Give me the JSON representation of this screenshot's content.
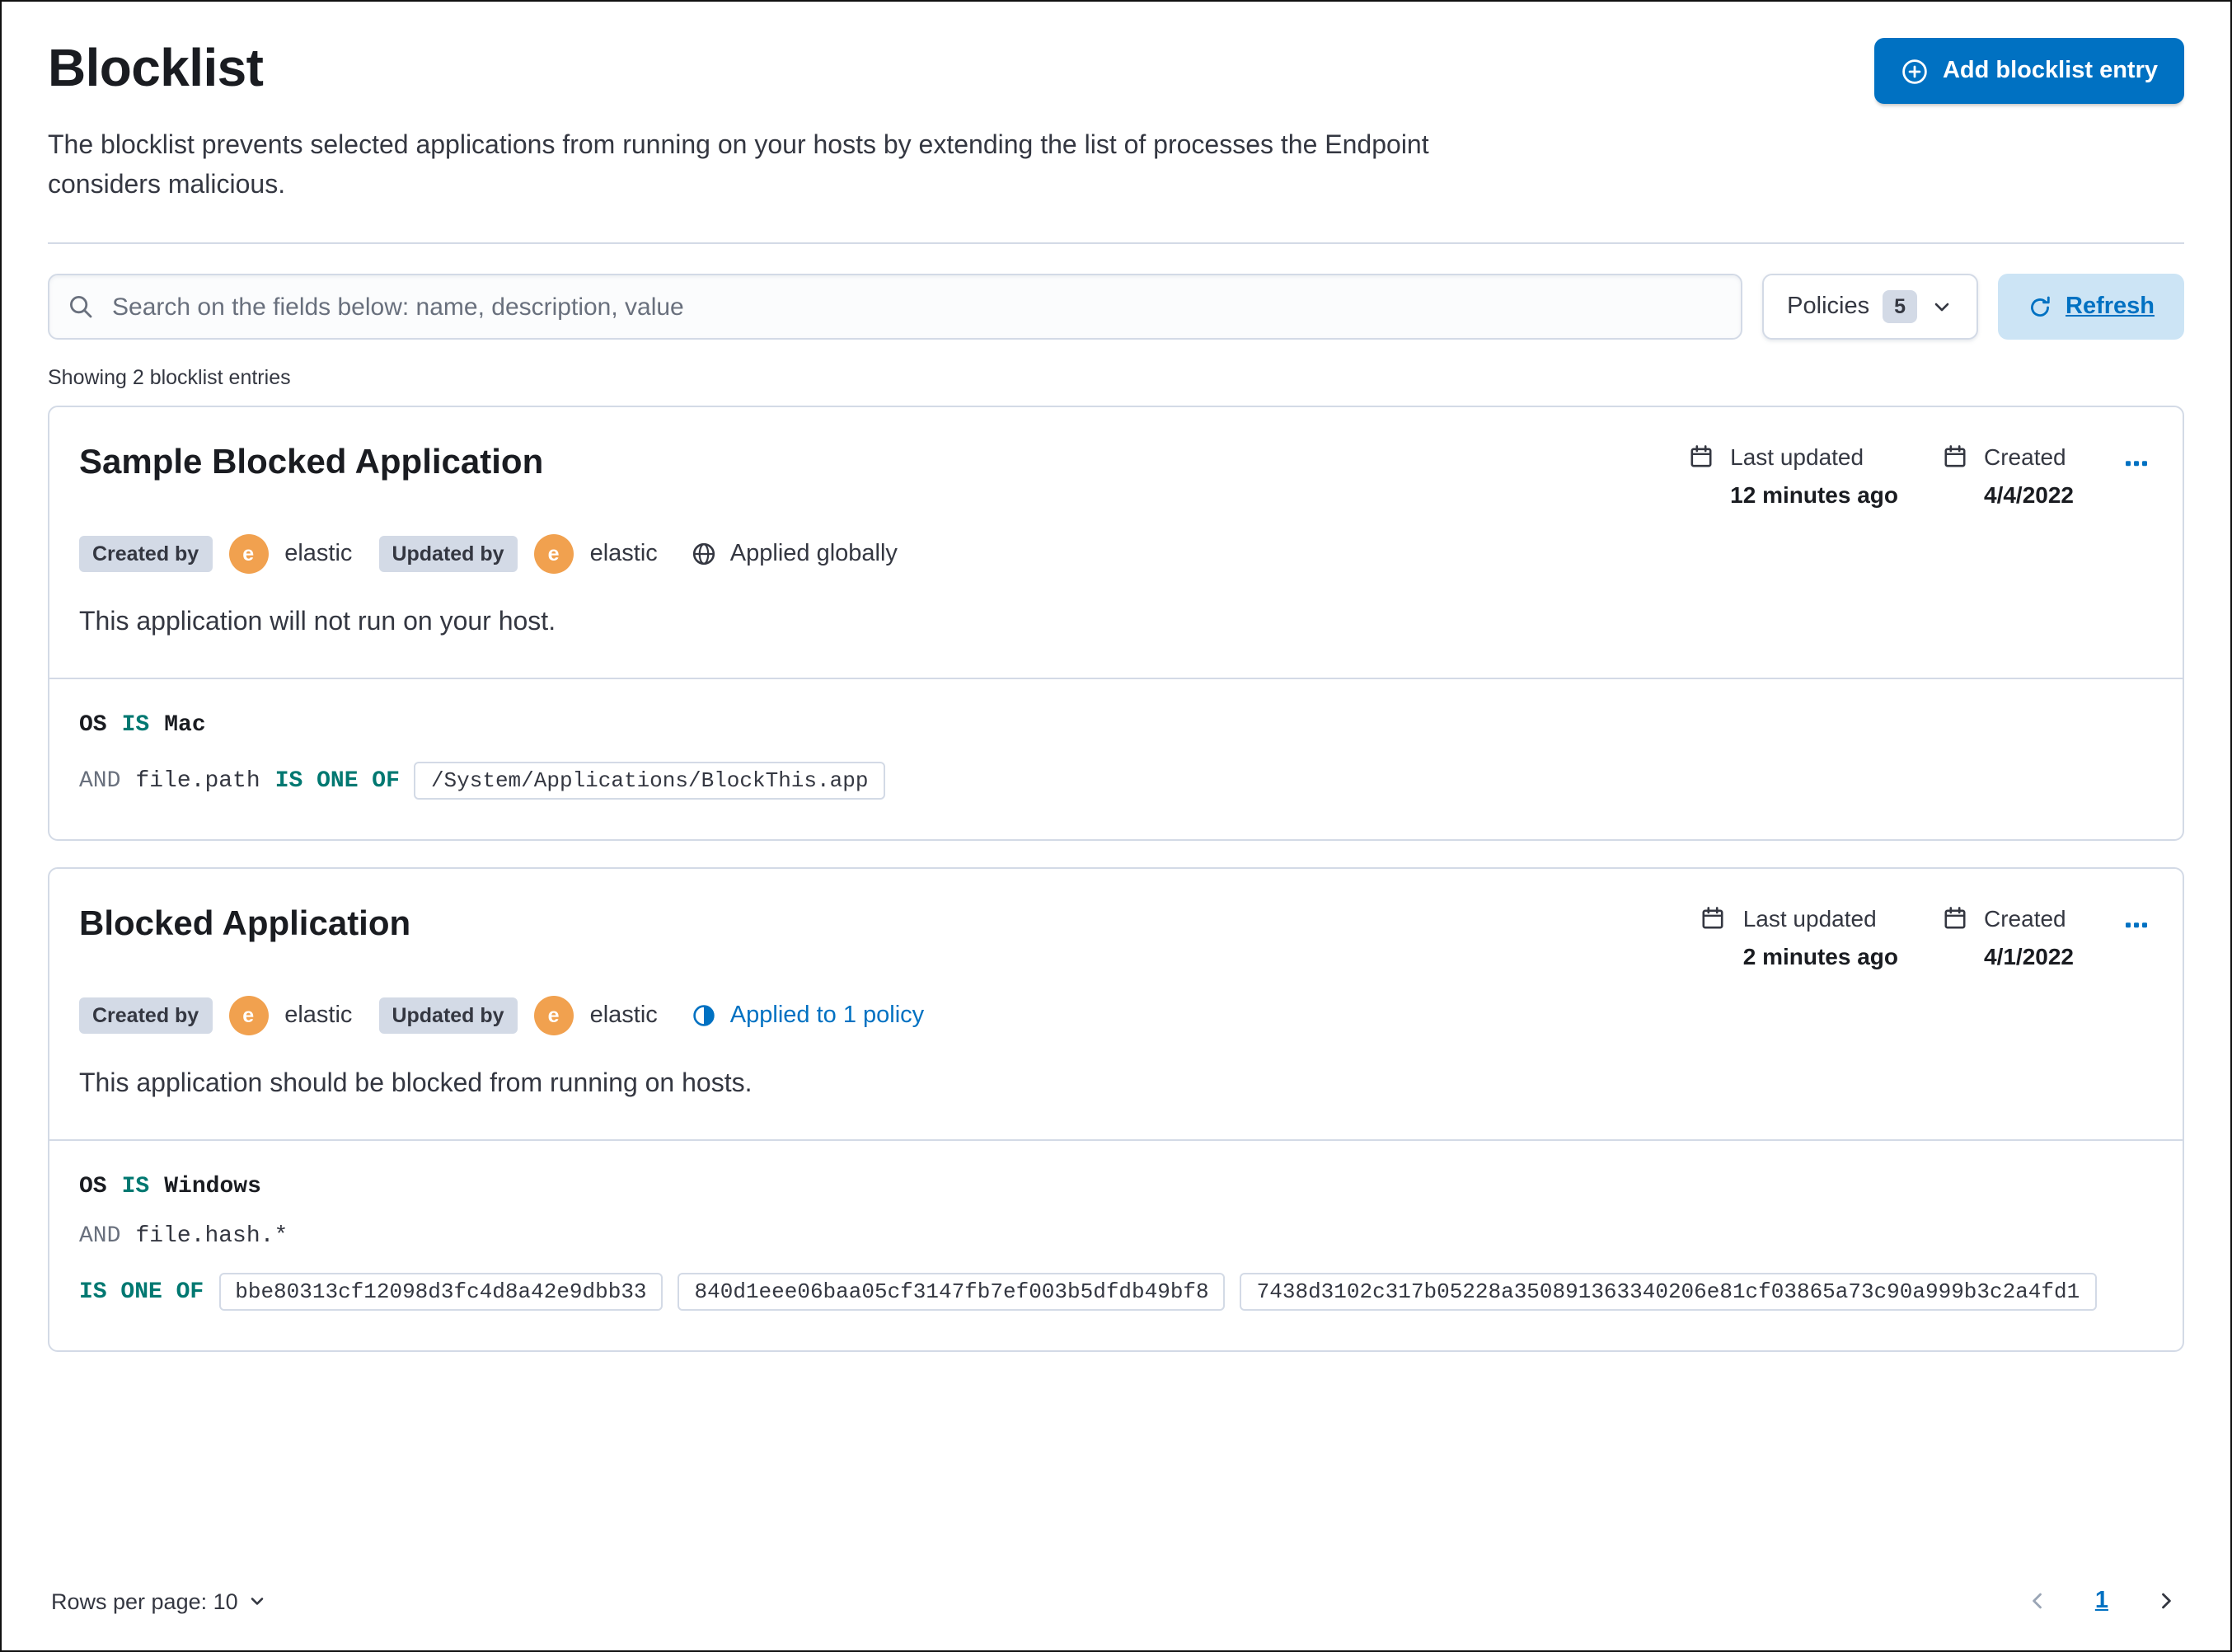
{
  "header": {
    "title": "Blocklist",
    "description": "The blocklist prevents selected applications from running on your hosts by extending the list of processes the Endpoint considers malicious.",
    "add_button_label": "Add blocklist entry"
  },
  "toolbar": {
    "search_placeholder": "Search on the fields below: name, description, value",
    "policies_label": "Policies",
    "policies_count": "5",
    "refresh_label": "Refresh"
  },
  "list": {
    "showing_text": "Showing 2 blocklist entries"
  },
  "entries": [
    {
      "title": "Sample Blocked Application",
      "created_by_label": "Created by",
      "created_by_user": "elastic",
      "updated_by_label": "Updated by",
      "updated_by_user": "elastic",
      "avatar_initial": "e",
      "applied_text": "Applied globally",
      "last_updated_label": "Last updated",
      "last_updated_value": "12 minutes ago",
      "created_label": "Created",
      "created_value": "4/4/2022",
      "description": "This application will not run on your host.",
      "criteria": [
        {
          "field": "OS",
          "operator": "IS",
          "value": "Mac"
        },
        {
          "prefix": "AND",
          "field": "file.path",
          "operator": "IS ONE OF",
          "values": [
            "/System/Applications/BlockThis.app"
          ]
        }
      ]
    },
    {
      "title": "Blocked Application",
      "created_by_label": "Created by",
      "created_by_user": "elastic",
      "updated_by_label": "Updated by",
      "updated_by_user": "elastic",
      "avatar_initial": "e",
      "applied_text": "Applied to 1 policy",
      "last_updated_label": "Last updated",
      "last_updated_value": "2 minutes ago",
      "created_label": "Created",
      "created_value": "4/1/2022",
      "description": "This application should be blocked from running on hosts.",
      "criteria": [
        {
          "field": "OS",
          "operator": "IS",
          "value": "Windows"
        },
        {
          "prefix": "AND",
          "field": "file.hash.*",
          "operator": "IS ONE OF",
          "values": [
            "bbe80313cf12098d3fc4d8a42e9dbb33",
            "840d1eee06baa05cf3147fb7ef003b5dfdb49bf8",
            "7438d3102c317b05228a350891363340206e81cf03865a73c90a999b3c2a4fd1"
          ]
        }
      ]
    }
  ],
  "footer": {
    "rows_per_page_label": "Rows per page: 10",
    "page_number": "1"
  },
  "icons": {
    "add": "plus-in-circle",
    "search": "magnifier",
    "policies_caret": "chevron-down",
    "refresh": "refresh-arrow",
    "date": "calendar",
    "global": "globe",
    "policy": "partial-circle",
    "actions": "boxes-horizontal",
    "pagination_prev": "chevron-left",
    "pagination_next": "chevron-right"
  },
  "colors": {
    "primary": "#0071c2",
    "primary_light_bg": "#cce4f5",
    "operator_teal": "#007871",
    "avatar_orange": "#f1a14f",
    "border": "#d3dae6",
    "badge_bg": "#d3dae6",
    "text": "#343741",
    "heading": "#1a1c21"
  }
}
